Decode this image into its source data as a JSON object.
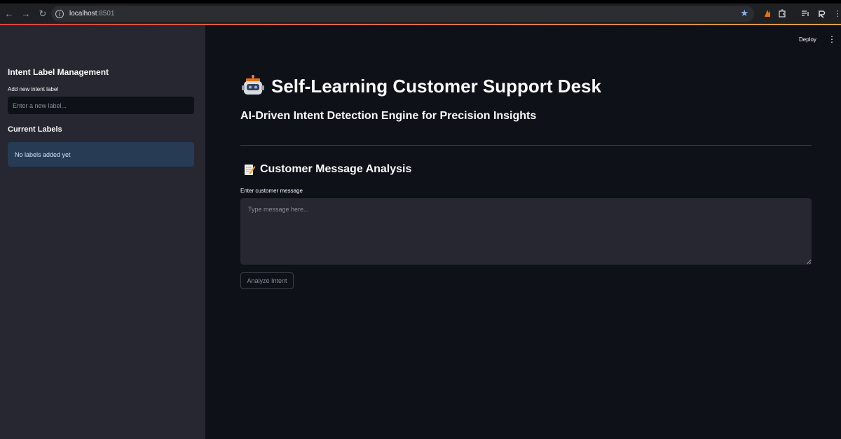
{
  "browser": {
    "url_host": "localhost",
    "url_port": ":8501",
    "icons": {
      "back": "back-arrow-icon",
      "forward": "forward-arrow-icon",
      "reload": "reload-icon",
      "site_info": "info-icon",
      "bookmark": "star-icon",
      "extensions": "puzzle-icon",
      "menu": "more-vertical-icon"
    }
  },
  "header": {
    "deploy_label": "Deploy"
  },
  "sidebar": {
    "title": "Intent Label Management",
    "new_label_field_label": "Add new intent label",
    "new_label_placeholder": "Enter a new label...",
    "current_labels_heading": "Current Labels",
    "empty_message": "No labels added yet"
  },
  "main": {
    "title_emoji": "robot-icon",
    "title": "Self-Learning Customer Support Desk",
    "subtitle": "AI-Driven Intent Detection Engine for Precision Insights",
    "section_icon": "memo-icon",
    "section_title": "Customer Message Analysis",
    "message_field_label": "Enter customer message",
    "message_placeholder": "Type message here...",
    "analyze_button": "Analyze Intent"
  },
  "colors": {
    "app_background": "#0e1117",
    "sidebar_background": "#262730",
    "info_background": "#273b54",
    "info_text": "#d3e7fb",
    "bookmark_star": "#8ab4f8"
  }
}
